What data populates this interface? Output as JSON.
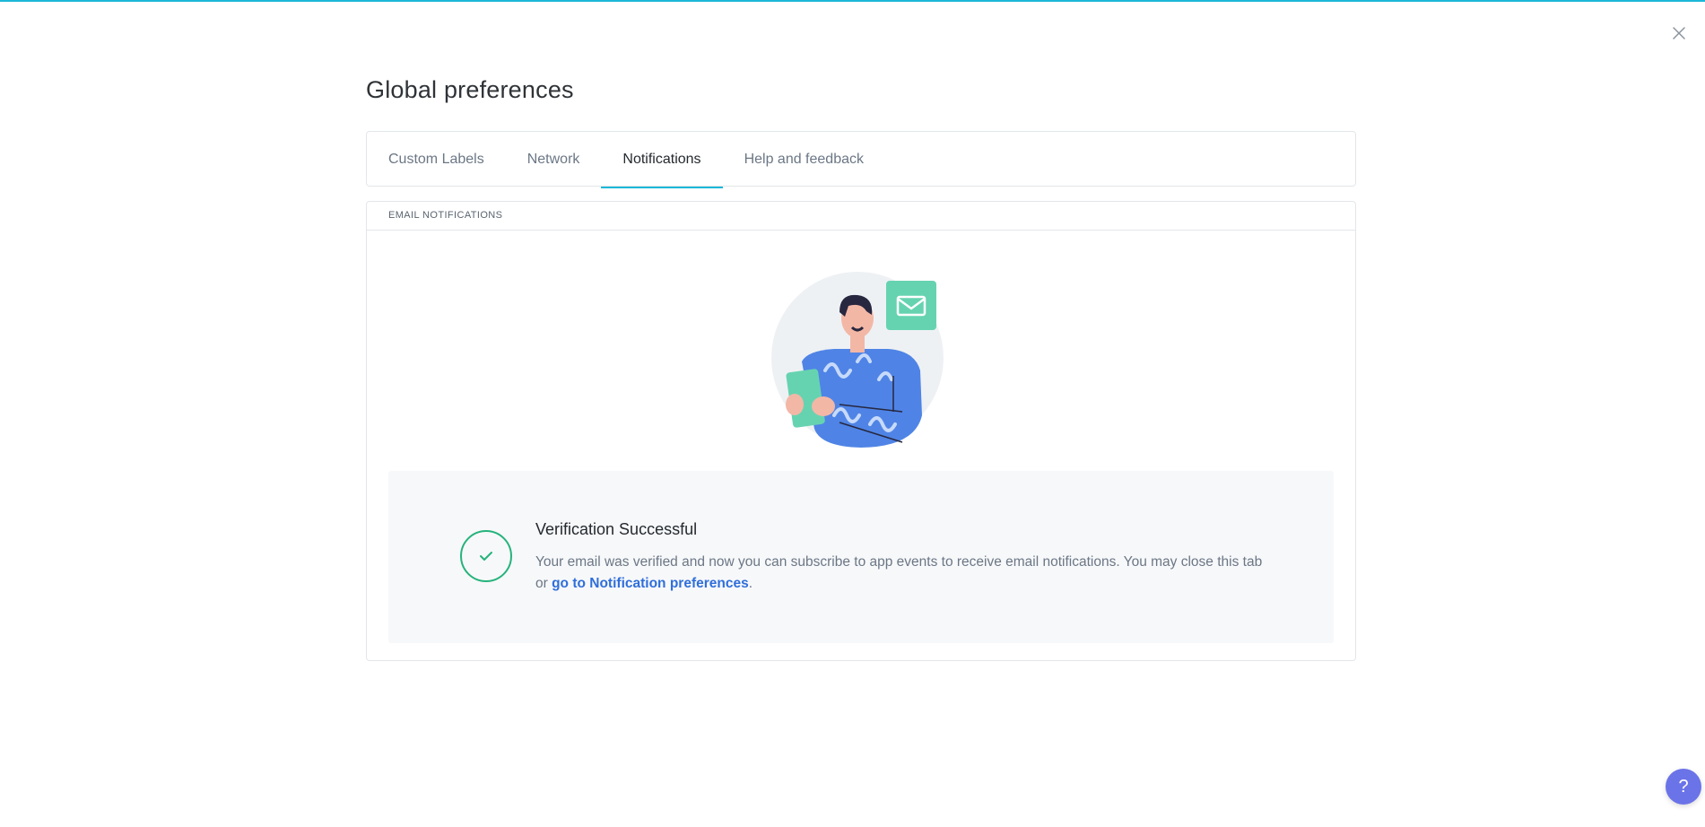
{
  "page": {
    "title": "Global preferences"
  },
  "tabs": [
    {
      "label": "Custom Labels",
      "active": false
    },
    {
      "label": "Network",
      "active": false
    },
    {
      "label": "Notifications",
      "active": true
    },
    {
      "label": "Help and feedback",
      "active": false
    }
  ],
  "panel": {
    "header": "EMAIL NOTIFICATIONS",
    "illustration_icon": "person-with-envelope-illustration"
  },
  "result": {
    "title": "Verification Successful",
    "message_before_link": "Your email was verified and now you can subscribe to app events to receive email notifications. You may close this tab or ",
    "link_text": "go to Notification preferences",
    "message_after_link": ".",
    "icon": "check-icon"
  },
  "help": {
    "label": "?"
  },
  "colors": {
    "accent": "#1ab8d8",
    "success": "#26b37c",
    "link": "#2f6fdb",
    "help_button": "#6b73e8"
  }
}
